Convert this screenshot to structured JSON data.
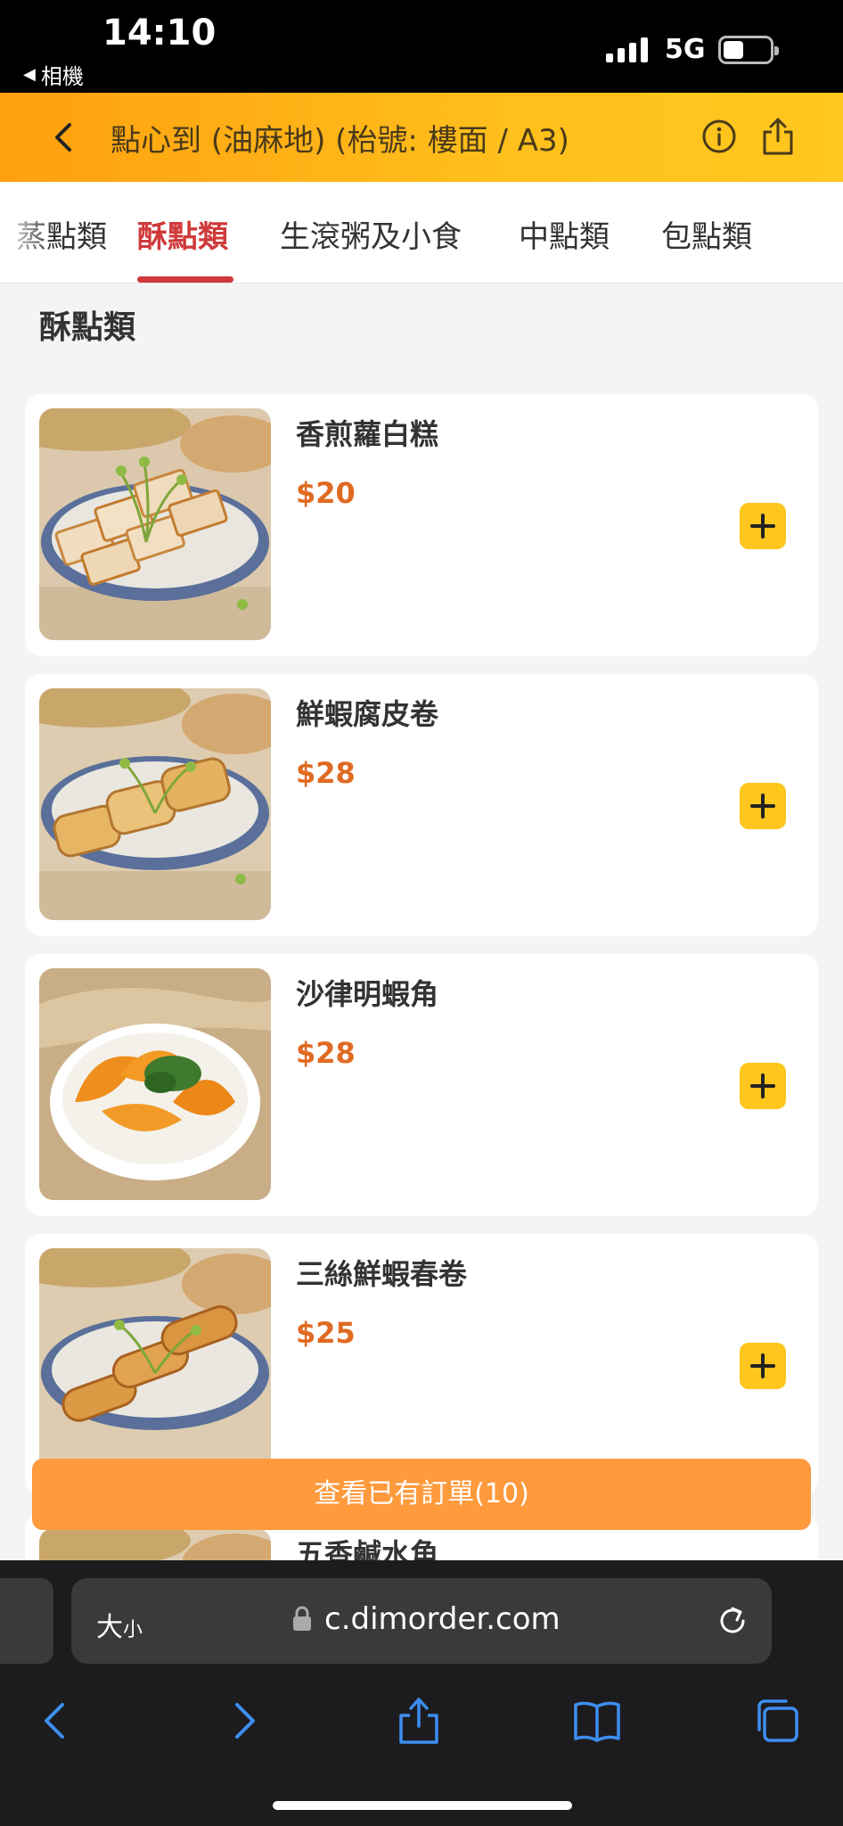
{
  "status_bar": {
    "time": "14:10",
    "back_app": "相機",
    "network": "5G"
  },
  "header": {
    "title": "點心到 (油麻地) (枱號: 樓面 / A3)",
    "icons": [
      "back-arrow-icon",
      "info-icon",
      "share-icon"
    ]
  },
  "tabs": [
    {
      "label": "蒸點類"
    },
    {
      "label": "酥點類",
      "active": true
    },
    {
      "label": "生滾粥及小食"
    },
    {
      "label": "中點類"
    },
    {
      "label": "包點類"
    }
  ],
  "section": {
    "title": "酥點類"
  },
  "items": [
    {
      "name": "香煎蘿白糕",
      "price": "$20",
      "image": "turnip-cake-photo"
    },
    {
      "name": "鮮蝦腐皮卷",
      "price": "$28",
      "image": "beancurd-roll-photo"
    },
    {
      "name": "沙律明蝦角",
      "price": "$28",
      "image": "shrimp-dumpling-photo"
    },
    {
      "name": "三絲鮮蝦春卷",
      "price": "$25",
      "image": "spring-roll-photo"
    },
    {
      "name": "五香鹹水角",
      "price": "",
      "image": "fried-dumpling-photo"
    }
  ],
  "order_bar": {
    "label": "查看已有訂單(10)"
  },
  "browser": {
    "text_size": "大",
    "text_size_small": "小",
    "url": "c.dimorder.com"
  },
  "colors": {
    "accent_red": "#d0393a",
    "price_orange": "#e06a22",
    "add_button": "#ffc61e",
    "order_bar": "#ff9a3d"
  }
}
